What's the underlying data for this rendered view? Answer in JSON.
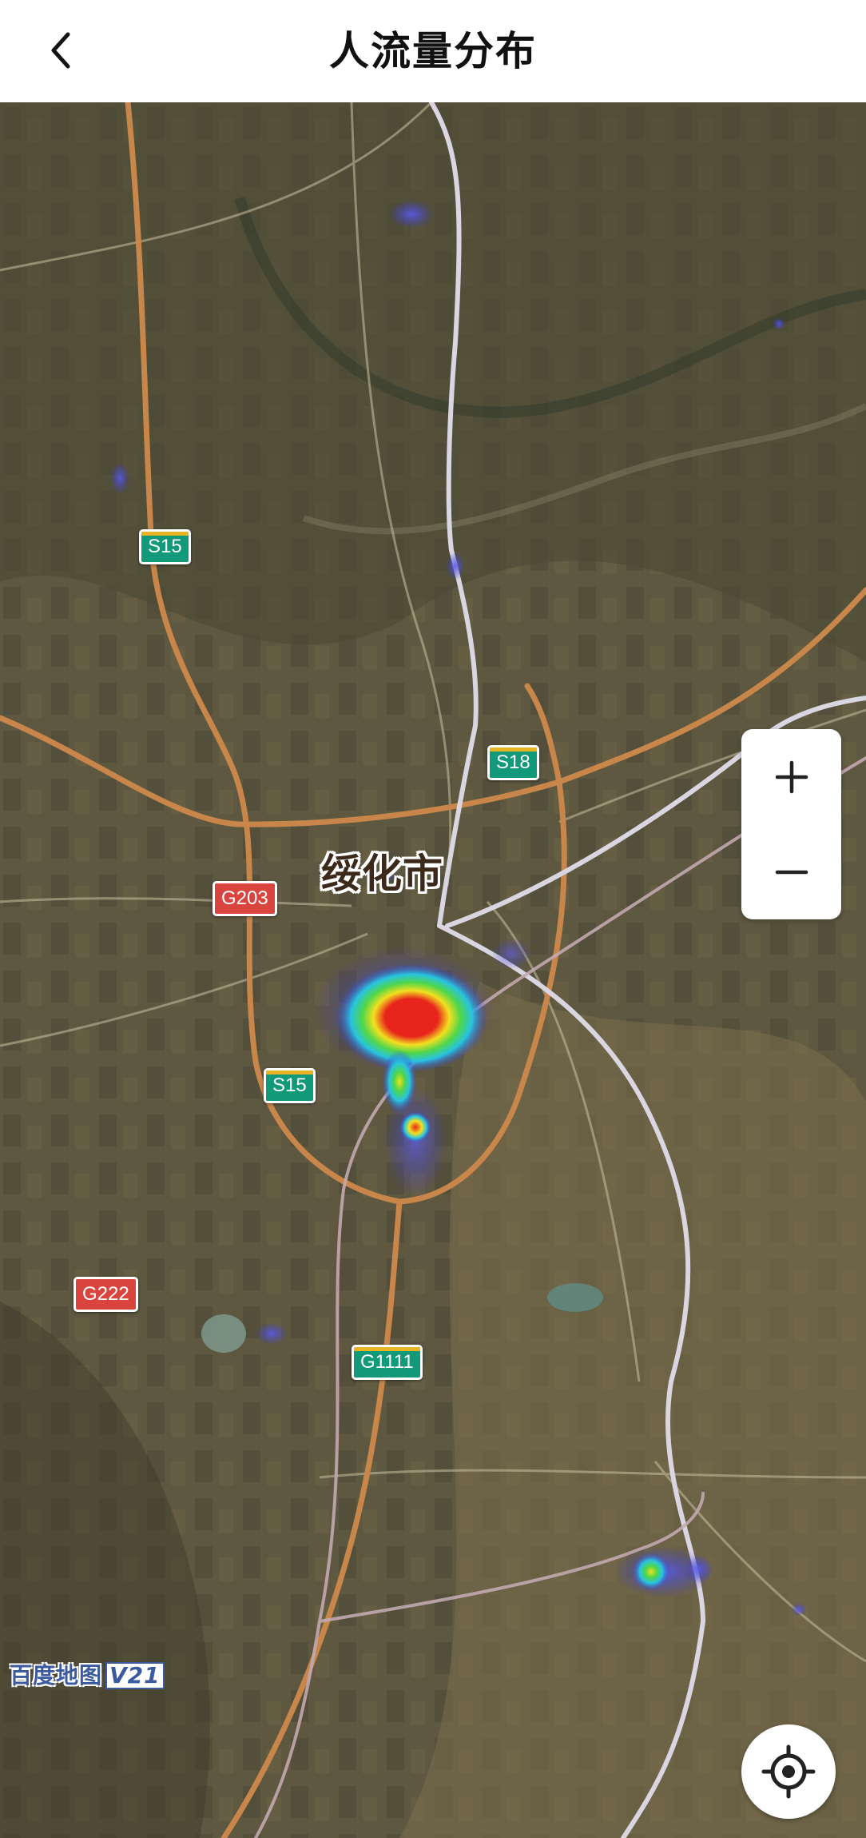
{
  "header": {
    "title": "人流量分布",
    "back_icon": "chevron-left-icon"
  },
  "map": {
    "city_label": "绥化市",
    "route_shields": [
      {
        "id": "s15-north",
        "label": "S15",
        "type": "provincial",
        "color": "#12997a"
      },
      {
        "id": "s18",
        "label": "S18",
        "type": "provincial",
        "color": "#12997a"
      },
      {
        "id": "g203",
        "label": "G203",
        "type": "national",
        "color": "#d9453e"
      },
      {
        "id": "s15-south",
        "label": "S15",
        "type": "provincial",
        "color": "#12997a"
      },
      {
        "id": "g222",
        "label": "G222",
        "type": "national",
        "color": "#d9453e"
      },
      {
        "id": "g1111",
        "label": "G1111",
        "type": "expressway",
        "color": "#12997a"
      }
    ],
    "watermark": {
      "text": "百度地图",
      "version": "V21"
    },
    "heat_colors": [
      "#3a3ad8",
      "#27c4e0",
      "#4fd64a",
      "#f2e01f",
      "#e8251c"
    ]
  },
  "controls": {
    "zoom_in": "+",
    "zoom_out": "−",
    "zoom_in_icon": "plus-icon",
    "zoom_out_icon": "minus-icon",
    "locate_icon": "crosshair-icon"
  }
}
